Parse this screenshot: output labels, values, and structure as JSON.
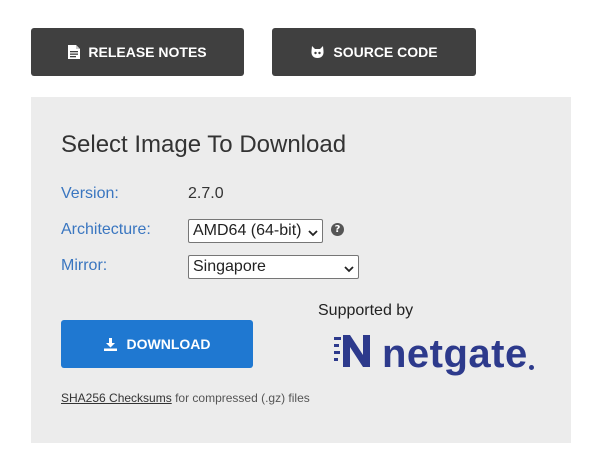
{
  "top_buttons": {
    "release_notes": "RELEASE NOTES",
    "source_code": "SOURCE CODE"
  },
  "panel": {
    "title": "Select Image To Download",
    "version_label": "Version:",
    "version_value": "2.7.0",
    "architecture_label": "Architecture:",
    "architecture_selected": "AMD64 (64-bit)",
    "mirror_label": "Mirror:",
    "mirror_selected": "Singapore",
    "help_symbol": "?",
    "download_label": "DOWNLOAD",
    "supported_by": "Supported by",
    "brand_name": "netgate",
    "checksums_link": "SHA256 Checksums",
    "checksums_suffix": "for compressed (.gz) files"
  },
  "colors": {
    "dark_button": "#404040",
    "download_button": "#1f78d1",
    "label_blue": "#3a76c0",
    "panel_bg": "#ececec",
    "netgate_brand": "#2d3a8c"
  },
  "icons": {
    "release_notes": "document-icon",
    "source_code": "github-icon",
    "download": "download-icon",
    "help": "question-circle-icon",
    "dropdown": "chevron-down-icon",
    "netgate_logo": "netgate-logo-icon"
  }
}
